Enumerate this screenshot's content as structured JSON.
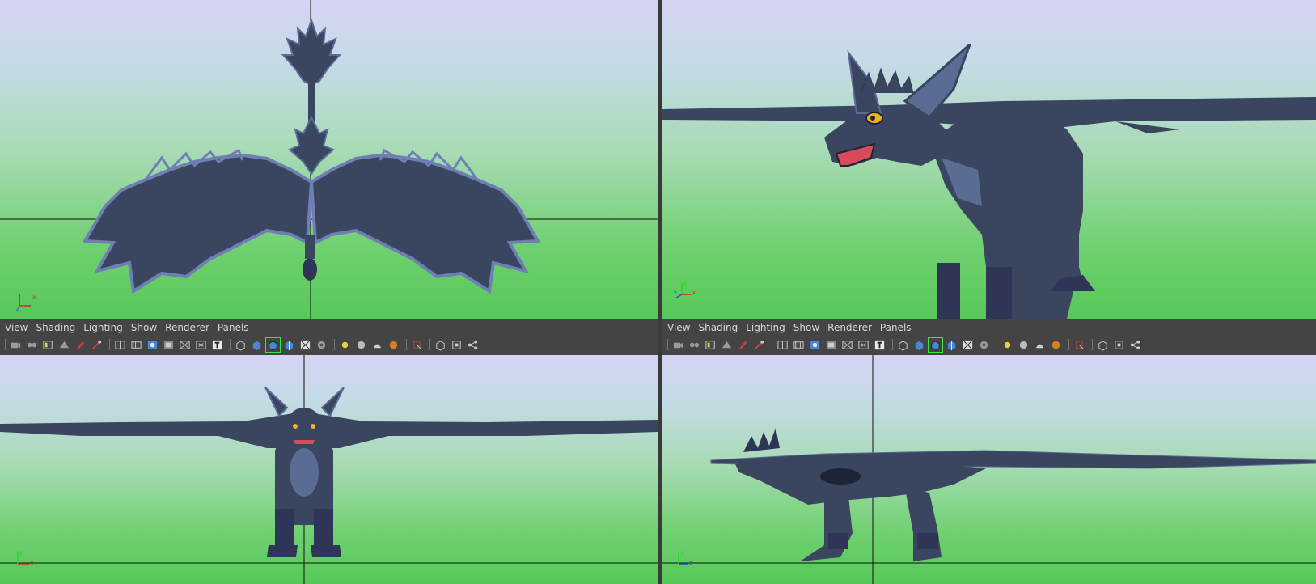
{
  "menus": {
    "left": [
      "View",
      "Shading",
      "Lighting",
      "Show",
      "Renderer",
      "Panels"
    ],
    "right": [
      "View",
      "Shading",
      "Lighting",
      "Show",
      "Renderer",
      "Panels"
    ]
  },
  "toolbar_icons": [
    "camera-attributes-icon",
    "bookmarks-icon",
    "image-plane-icon",
    "2d-pan-zoom-icon",
    "grease-pencil-icon",
    "select-camera-icon",
    "grid-icon",
    "film-gate-icon",
    "resolution-gate-icon",
    "gate-mask-icon",
    "field-chart-icon",
    "safe-action-icon",
    "safe-title-icon",
    "wireframe-icon",
    "smooth-shade-icon",
    "wireframe-on-shaded-icon",
    "textured-icon",
    "use-all-lights-icon",
    "shadows-icon",
    "screen-space-ao-icon",
    "motion-blur-icon",
    "multisample-aa-icon",
    "depth-of-field-icon",
    "isolate-select-icon",
    "xray-icon",
    "xray-active-component-icon",
    "xray-joints-icon"
  ],
  "colors": {
    "body": "#3a4560",
    "body_light": "#5a6b94",
    "wing_edge": "#6f7fb5",
    "crest": "#2f3556",
    "eye": "#f2b21c",
    "mouth": "#d94a5a",
    "toolbar_bg": "#444444",
    "active_outline": "#38e838"
  },
  "axis_labels": {
    "x": "x",
    "y": "y",
    "z": "z"
  }
}
